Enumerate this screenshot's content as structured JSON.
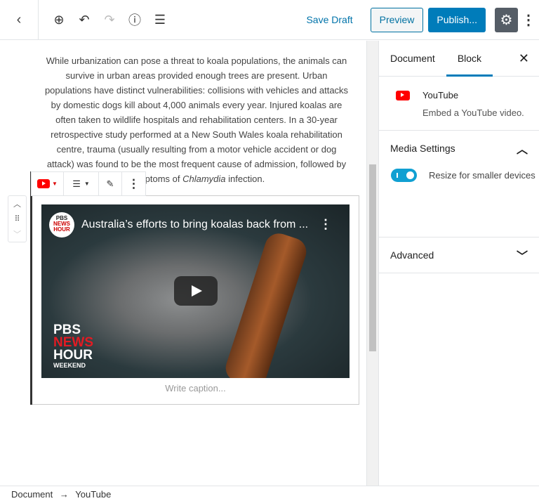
{
  "header": {
    "back_icon": "chevron-left-icon",
    "save_draft": "Save Draft",
    "preview": "Preview",
    "publish": "Publish...",
    "tools": [
      "add-block-icon",
      "undo-icon",
      "redo-icon",
      "info-icon",
      "outline-icon"
    ]
  },
  "content": {
    "paragraph_before": "While urbanization can pose a threat to koala populations, the animals can survive in urban areas provided enough trees are present. Urban populations have distinct vulnerabilities: collisions with vehicles and attacks by domestic dogs kill about 4,000 animals every year. Injured koalas are often taken to wildlife hospitals and rehabilitation centers. In a 30-year retrospective study performed at a New South Wales koala rehabilitation centre, trauma (usually resulting from a motor vehicle accident or dog attack) was found to be the most frequent cause of admission, followed by symptoms of ",
    "paragraph_em": "Chlamydia",
    "paragraph_after": " infection.",
    "video": {
      "title": "Australia’s efforts to bring koalas back from ...",
      "channel_logo": "PBS NEWS HOUR",
      "brand_line1": "PBS",
      "brand_line2": "NEWS",
      "brand_line3": "HOUR",
      "brand_line4": "WEEKEND"
    },
    "caption_placeholder": "Write caption..."
  },
  "sidebar": {
    "tabs": [
      "Document",
      "Block"
    ],
    "active_tab": "Block",
    "block_name": "YouTube",
    "block_desc": "Embed a YouTube video.",
    "media_settings": "Media Settings",
    "toggle_label": "Resize for smaller devices",
    "toggle_on": true,
    "advanced": "Advanced"
  },
  "breadcrumb": {
    "root": "Document",
    "sep": "→",
    "current": "YouTube"
  },
  "colors": {
    "accent": "#007cba",
    "youtube": "#ff0000"
  }
}
